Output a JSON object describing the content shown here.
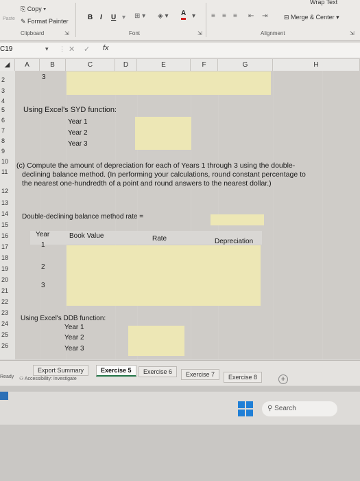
{
  "ribbon": {
    "wrap_text": "Wrap Text",
    "copy": "Copy",
    "format_painter": "Format Painter",
    "paste": "Paste",
    "clipboard": "Clipboard",
    "font": "Font",
    "alignment": "Alignment",
    "merge_center": "Merge & Center",
    "bold": "B",
    "italic": "I",
    "underline": "U"
  },
  "formula_bar": {
    "name_box": "C19",
    "fx": "fx",
    "value": ""
  },
  "columns": [
    "A",
    "B",
    "C",
    "D",
    "E",
    "F",
    "G",
    "H"
  ],
  "rows": [
    "2",
    "3",
    "4",
    "5",
    "6",
    "7",
    "8",
    "9",
    "10",
    "11",
    "12",
    "13",
    "14",
    "15",
    "16",
    "17",
    "18",
    "19",
    "20",
    "21",
    "22",
    "23",
    "24",
    "25",
    "26"
  ],
  "sheet": {
    "r1_b": "3",
    "syd_label": "Using Excel's SYD function:",
    "syd_y1": "Year 1",
    "syd_y2": "Year 2",
    "syd_y3": "Year 3",
    "partc_l1": "(c)  Compute the amount of depreciation for each of Years 1 through 3 using the double-",
    "partc_l2": "declining balance method. (In performing your calculations, round constant percentage to",
    "partc_l3": "the nearest one-hundredth of a point and round answers to the nearest dollar.)",
    "ddb_rate": "Double-declining balance method rate =",
    "col_year": "Year",
    "col_book": "Book Value",
    "col_rate": "Rate",
    "col_dep": "Depreciation",
    "year1": "1",
    "year2": "2",
    "year3": "3",
    "ddb_label": "Using Excel's DDB function:",
    "ddb_y1": "Year 1",
    "ddb_y2": "Year 2",
    "ddb_y3": "Year 3"
  },
  "tabs": {
    "items": [
      "Export Summary",
      "Exercise 5",
      "Exercise 6",
      "Exercise 7",
      "Exercise 8"
    ],
    "active": "Exercise 5",
    "status": "Ready",
    "accessibility": "Accessibility: Investigate"
  },
  "taskbar": {
    "search": "Search"
  }
}
